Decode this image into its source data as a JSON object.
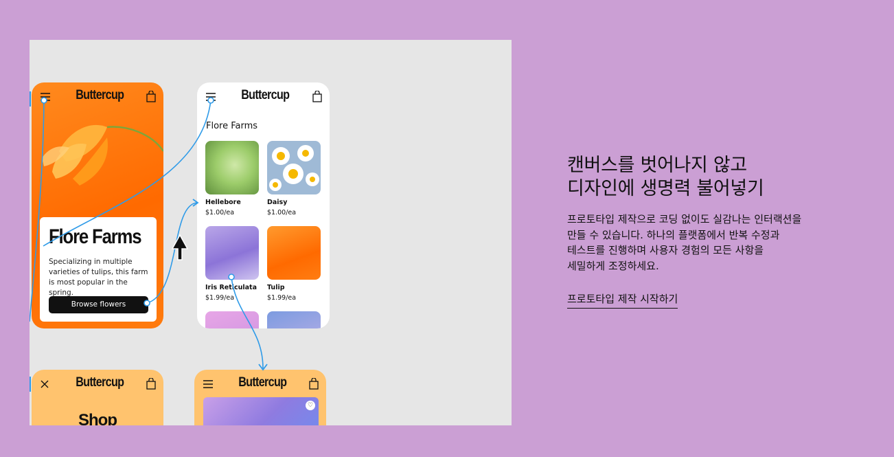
{
  "canvas": {
    "frame1": {
      "brand": "Buttercup",
      "card_title": "Flore Farms",
      "card_desc": "Specializing in multiple varieties of tulips, this farm is most popular in the spring.",
      "button": "Browse flowers"
    },
    "frame2": {
      "brand": "Buttercup",
      "section_title": "Flore Farms",
      "products": [
        {
          "name": "Hellebore",
          "price": "$1.00/ea"
        },
        {
          "name": "Daisy",
          "price": "$1.00/ea"
        },
        {
          "name": "Iris Reticulata",
          "price": "$1.99/ea"
        },
        {
          "name": "Tulip",
          "price": "$1.99/ea"
        }
      ]
    },
    "frame3": {
      "brand": "Buttercup",
      "heading": "Shop"
    },
    "frame4": {
      "brand": "Buttercup"
    }
  },
  "promo": {
    "headline_line1": "캔버스를 벗어나지 않고",
    "headline_line2": "디자인에 생명력 불어넣기",
    "body_line1": "프로토타입 제작으로 코딩 없이도 실감나는 인터랙션을",
    "body_line2": "만들 수 있습니다. 하나의 플랫폼에서 반복 수정과",
    "body_line3": "테스트를 진행하며 사용자 경험의 모든 사항을",
    "body_line4": "세밀하게 조정하세요.",
    "cta": "프로토타입 제작 시작하기"
  },
  "colors": {
    "background": "#cb9fd4",
    "canvas": "#e6e6e6",
    "accent_orange": "#ff6a00",
    "connector_blue": "#2f9be8",
    "frame_yellow": "#ffc36e"
  },
  "icons": [
    "menu-icon",
    "shopping-bag-icon",
    "close-icon",
    "heart-icon",
    "cursor-arrow-icon"
  ]
}
